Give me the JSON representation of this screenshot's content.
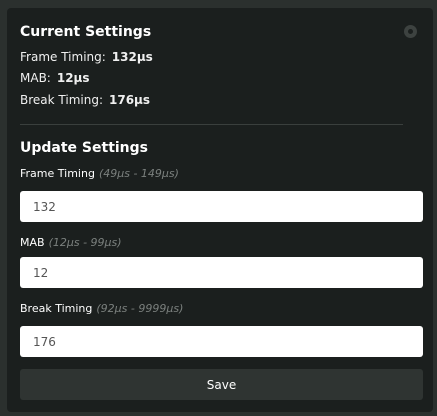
{
  "current": {
    "title": "Current Settings",
    "frame_timing_label": "Frame Timing:",
    "frame_timing_value": "132µs",
    "mab_label": "MAB:",
    "mab_value": "12µs",
    "break_timing_label": "Break Timing:",
    "break_timing_value": "176µs"
  },
  "update": {
    "title": "Update Settings",
    "fields": [
      {
        "label": "Frame Timing",
        "range": "(49µs - 149µs)",
        "value": "132"
      },
      {
        "label": "MAB",
        "range": "(12µs - 99µs)",
        "value": "12"
      },
      {
        "label": "Break Timing",
        "range": "(92µs - 9999µs)",
        "value": "176"
      }
    ],
    "save_label": "Save"
  },
  "icons": {
    "settings": "gear-icon"
  },
  "colors": {
    "background": "#2b302e",
    "panel": "#1b1f1e",
    "button": "#2f3432"
  }
}
